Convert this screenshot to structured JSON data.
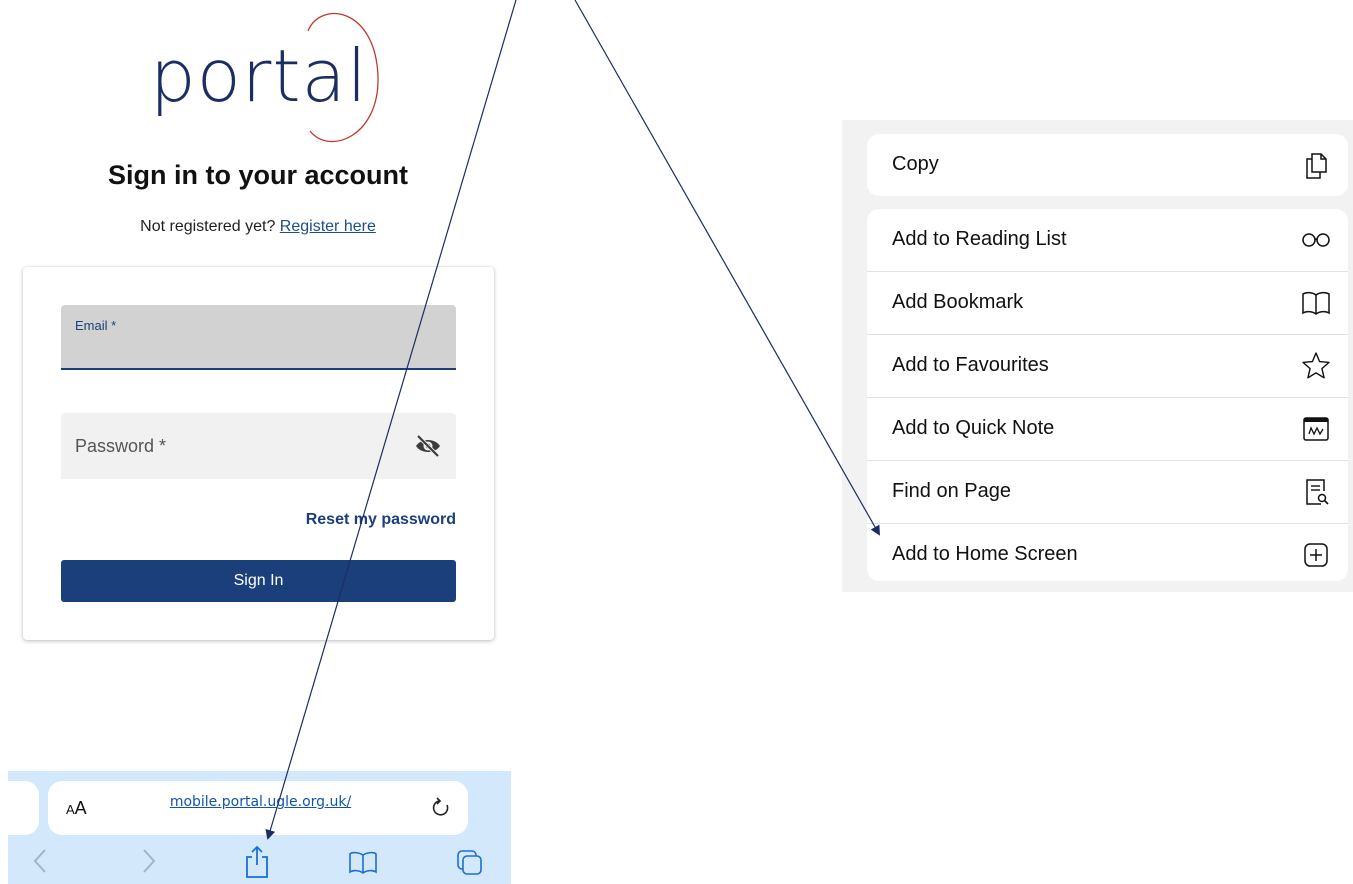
{
  "logo": {
    "text": "portal"
  },
  "signin": {
    "title": "Sign in to your account",
    "not_registered": "Not registered yet?",
    "register_link": "Register here",
    "email_label": "Email *",
    "password_label": "Password *",
    "reset_link": "Reset my password",
    "button": "Sign In"
  },
  "browser": {
    "aa_small": "A",
    "aa_large": "A",
    "url": "mobile.portal.ugle.org.uk/"
  },
  "share_menu": {
    "copy": {
      "label": "Copy",
      "icon": "copy-icon"
    },
    "items": [
      {
        "label": "Add to Reading List",
        "icon": "glasses-icon"
      },
      {
        "label": "Add Bookmark",
        "icon": "book-icon"
      },
      {
        "label": "Add to Favourites",
        "icon": "star-icon"
      },
      {
        "label": "Add to Quick Note",
        "icon": "quick-note-icon"
      },
      {
        "label": "Find on Page",
        "icon": "find-on-page-icon"
      },
      {
        "label": "Add to Home Screen",
        "icon": "add-square-icon"
      }
    ]
  },
  "colors": {
    "brand_navy": "#1b3f7a",
    "logo_arc": "#c0392b",
    "safari_bar": "#d3e8fb"
  }
}
